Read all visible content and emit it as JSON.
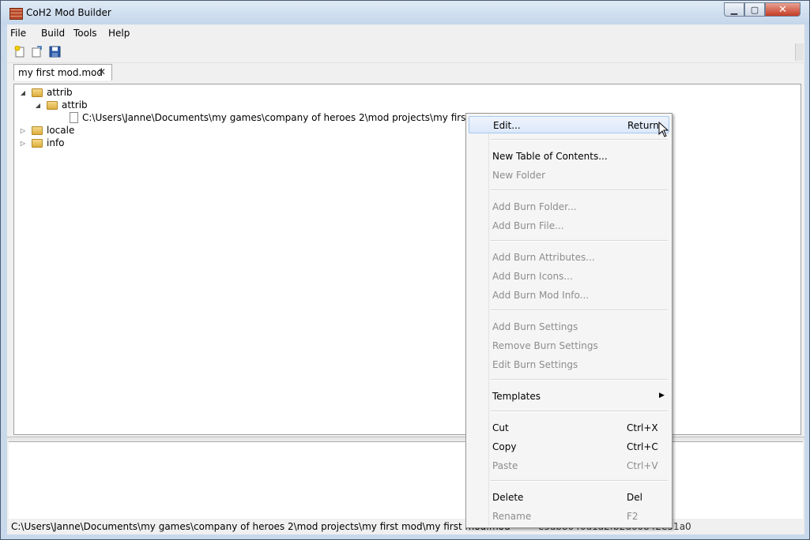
{
  "window": {
    "title": "CoH2 Mod Builder"
  },
  "menubar": {
    "items": [
      "File",
      "Build",
      "Tools",
      "Help"
    ]
  },
  "toolbar": {
    "icons": [
      "new-file-icon",
      "open-file-icon",
      "save-icon"
    ]
  },
  "tab": {
    "label": "my first mod.mod",
    "close_glyph": "✕"
  },
  "tree": {
    "root1": "attrib",
    "child1": "attrib",
    "file1": "C:\\Users\\Janne\\Documents\\my games\\company of heroes 2\\mod projects\\my first mod\\attrib",
    "root2": "locale",
    "root3": "info"
  },
  "status": {
    "path": "C:\\Users\\Janne\\Documents\\my games\\company of heroes 2\\mod projects\\my first mod\\my first mod.mod",
    "guid_partial": "e5ab8040d1a2fb2d60842e51a0"
  },
  "context_menu": {
    "edit": {
      "label": "Edit...",
      "shortcut": "Return"
    },
    "new_toc": "New Table of Contents...",
    "new_folder": "New Folder",
    "add_burn_folder": "Add Burn Folder...",
    "add_burn_file": "Add Burn File...",
    "add_burn_attributes": "Add Burn Attributes...",
    "add_burn_icons": "Add Burn Icons...",
    "add_burn_mod_info": "Add Burn Mod Info...",
    "add_burn_settings": "Add Burn Settings",
    "remove_burn_settings": "Remove Burn Settings",
    "edit_burn_settings": "Edit Burn Settings",
    "templates": "Templates",
    "cut": {
      "label": "Cut",
      "shortcut": "Ctrl+X"
    },
    "copy": {
      "label": "Copy",
      "shortcut": "Ctrl+C"
    },
    "paste": {
      "label": "Paste",
      "shortcut": "Ctrl+V"
    },
    "delete": {
      "label": "Delete",
      "shortcut": "Del"
    },
    "rename": {
      "label": "Rename",
      "shortcut": "F2"
    }
  },
  "colors": {
    "accent": "#3399ff",
    "titlebar": "#c9d9ec",
    "close": "#c43b23"
  }
}
